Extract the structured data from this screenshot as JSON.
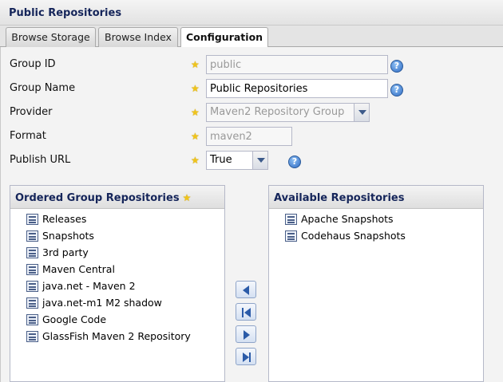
{
  "panel": {
    "title": "Public Repositories"
  },
  "tabs": [
    {
      "label": "Browse Storage",
      "active": false
    },
    {
      "label": "Browse Index",
      "active": false
    },
    {
      "label": "Configuration",
      "active": true
    }
  ],
  "form": {
    "group_id": {
      "label": "Group ID",
      "value": "public"
    },
    "group_name": {
      "label": "Group Name",
      "value": "Public Repositories"
    },
    "provider": {
      "label": "Provider",
      "value": "Maven2 Repository Group"
    },
    "format": {
      "label": "Format",
      "value": "maven2"
    },
    "publish_url": {
      "label": "Publish URL",
      "value": "True"
    }
  },
  "ordered": {
    "title": "Ordered Group Repositories",
    "items": [
      "Releases",
      "Snapshots",
      "3rd party",
      "Maven Central",
      "java.net - Maven 2",
      "java.net-m1 M2 shadow",
      "Google Code",
      "GlassFish Maven 2 Repository"
    ]
  },
  "available": {
    "title": "Available Repositories",
    "items": [
      "Apache Snapshots",
      "Codehaus Snapshots"
    ]
  },
  "icons": {
    "required": "star-icon",
    "help": "help-icon",
    "repository": "repository-icon",
    "move_left": "arrow-left-icon",
    "move_all_left": "arrow-first-icon",
    "move_right": "arrow-right-icon",
    "move_all_right": "arrow-last-icon"
  },
  "colors": {
    "header_text": "#15255a",
    "required_star": "#f0c419",
    "help_blue": "#2f6bc3"
  }
}
